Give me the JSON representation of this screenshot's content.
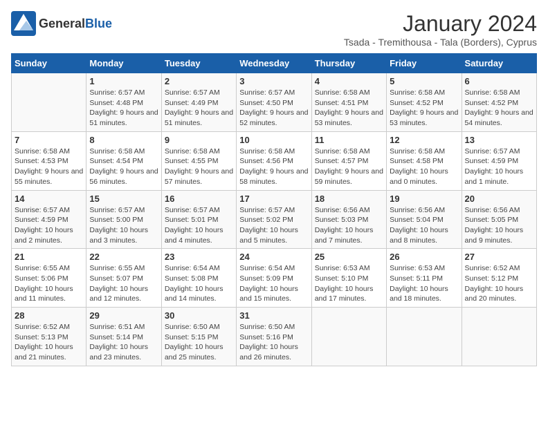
{
  "logo": {
    "general": "General",
    "blue": "Blue"
  },
  "title": "January 2024",
  "subtitle": "Tsada - Tremithousa - Tala (Borders), Cyprus",
  "days_of_week": [
    "Sunday",
    "Monday",
    "Tuesday",
    "Wednesday",
    "Thursday",
    "Friday",
    "Saturday"
  ],
  "weeks": [
    [
      {
        "day": "",
        "sunrise": "",
        "sunset": "",
        "daylight": ""
      },
      {
        "day": "1",
        "sunrise": "Sunrise: 6:57 AM",
        "sunset": "Sunset: 4:48 PM",
        "daylight": "Daylight: 9 hours and 51 minutes."
      },
      {
        "day": "2",
        "sunrise": "Sunrise: 6:57 AM",
        "sunset": "Sunset: 4:49 PM",
        "daylight": "Daylight: 9 hours and 51 minutes."
      },
      {
        "day": "3",
        "sunrise": "Sunrise: 6:57 AM",
        "sunset": "Sunset: 4:50 PM",
        "daylight": "Daylight: 9 hours and 52 minutes."
      },
      {
        "day": "4",
        "sunrise": "Sunrise: 6:58 AM",
        "sunset": "Sunset: 4:51 PM",
        "daylight": "Daylight: 9 hours and 53 minutes."
      },
      {
        "day": "5",
        "sunrise": "Sunrise: 6:58 AM",
        "sunset": "Sunset: 4:52 PM",
        "daylight": "Daylight: 9 hours and 53 minutes."
      },
      {
        "day": "6",
        "sunrise": "Sunrise: 6:58 AM",
        "sunset": "Sunset: 4:52 PM",
        "daylight": "Daylight: 9 hours and 54 minutes."
      }
    ],
    [
      {
        "day": "7",
        "sunrise": "Sunrise: 6:58 AM",
        "sunset": "Sunset: 4:53 PM",
        "daylight": "Daylight: 9 hours and 55 minutes."
      },
      {
        "day": "8",
        "sunrise": "Sunrise: 6:58 AM",
        "sunset": "Sunset: 4:54 PM",
        "daylight": "Daylight: 9 hours and 56 minutes."
      },
      {
        "day": "9",
        "sunrise": "Sunrise: 6:58 AM",
        "sunset": "Sunset: 4:55 PM",
        "daylight": "Daylight: 9 hours and 57 minutes."
      },
      {
        "day": "10",
        "sunrise": "Sunrise: 6:58 AM",
        "sunset": "Sunset: 4:56 PM",
        "daylight": "Daylight: 9 hours and 58 minutes."
      },
      {
        "day": "11",
        "sunrise": "Sunrise: 6:58 AM",
        "sunset": "Sunset: 4:57 PM",
        "daylight": "Daylight: 9 hours and 59 minutes."
      },
      {
        "day": "12",
        "sunrise": "Sunrise: 6:58 AM",
        "sunset": "Sunset: 4:58 PM",
        "daylight": "Daylight: 10 hours and 0 minutes."
      },
      {
        "day": "13",
        "sunrise": "Sunrise: 6:57 AM",
        "sunset": "Sunset: 4:59 PM",
        "daylight": "Daylight: 10 hours and 1 minute."
      }
    ],
    [
      {
        "day": "14",
        "sunrise": "Sunrise: 6:57 AM",
        "sunset": "Sunset: 4:59 PM",
        "daylight": "Daylight: 10 hours and 2 minutes."
      },
      {
        "day": "15",
        "sunrise": "Sunrise: 6:57 AM",
        "sunset": "Sunset: 5:00 PM",
        "daylight": "Daylight: 10 hours and 3 minutes."
      },
      {
        "day": "16",
        "sunrise": "Sunrise: 6:57 AM",
        "sunset": "Sunset: 5:01 PM",
        "daylight": "Daylight: 10 hours and 4 minutes."
      },
      {
        "day": "17",
        "sunrise": "Sunrise: 6:57 AM",
        "sunset": "Sunset: 5:02 PM",
        "daylight": "Daylight: 10 hours and 5 minutes."
      },
      {
        "day": "18",
        "sunrise": "Sunrise: 6:56 AM",
        "sunset": "Sunset: 5:03 PM",
        "daylight": "Daylight: 10 hours and 7 minutes."
      },
      {
        "day": "19",
        "sunrise": "Sunrise: 6:56 AM",
        "sunset": "Sunset: 5:04 PM",
        "daylight": "Daylight: 10 hours and 8 minutes."
      },
      {
        "day": "20",
        "sunrise": "Sunrise: 6:56 AM",
        "sunset": "Sunset: 5:05 PM",
        "daylight": "Daylight: 10 hours and 9 minutes."
      }
    ],
    [
      {
        "day": "21",
        "sunrise": "Sunrise: 6:55 AM",
        "sunset": "Sunset: 5:06 PM",
        "daylight": "Daylight: 10 hours and 11 minutes."
      },
      {
        "day": "22",
        "sunrise": "Sunrise: 6:55 AM",
        "sunset": "Sunset: 5:07 PM",
        "daylight": "Daylight: 10 hours and 12 minutes."
      },
      {
        "day": "23",
        "sunrise": "Sunrise: 6:54 AM",
        "sunset": "Sunset: 5:08 PM",
        "daylight": "Daylight: 10 hours and 14 minutes."
      },
      {
        "day": "24",
        "sunrise": "Sunrise: 6:54 AM",
        "sunset": "Sunset: 5:09 PM",
        "daylight": "Daylight: 10 hours and 15 minutes."
      },
      {
        "day": "25",
        "sunrise": "Sunrise: 6:53 AM",
        "sunset": "Sunset: 5:10 PM",
        "daylight": "Daylight: 10 hours and 17 minutes."
      },
      {
        "day": "26",
        "sunrise": "Sunrise: 6:53 AM",
        "sunset": "Sunset: 5:11 PM",
        "daylight": "Daylight: 10 hours and 18 minutes."
      },
      {
        "day": "27",
        "sunrise": "Sunrise: 6:52 AM",
        "sunset": "Sunset: 5:12 PM",
        "daylight": "Daylight: 10 hours and 20 minutes."
      }
    ],
    [
      {
        "day": "28",
        "sunrise": "Sunrise: 6:52 AM",
        "sunset": "Sunset: 5:13 PM",
        "daylight": "Daylight: 10 hours and 21 minutes."
      },
      {
        "day": "29",
        "sunrise": "Sunrise: 6:51 AM",
        "sunset": "Sunset: 5:14 PM",
        "daylight": "Daylight: 10 hours and 23 minutes."
      },
      {
        "day": "30",
        "sunrise": "Sunrise: 6:50 AM",
        "sunset": "Sunset: 5:15 PM",
        "daylight": "Daylight: 10 hours and 25 minutes."
      },
      {
        "day": "31",
        "sunrise": "Sunrise: 6:50 AM",
        "sunset": "Sunset: 5:16 PM",
        "daylight": "Daylight: 10 hours and 26 minutes."
      },
      {
        "day": "",
        "sunrise": "",
        "sunset": "",
        "daylight": ""
      },
      {
        "day": "",
        "sunrise": "",
        "sunset": "",
        "daylight": ""
      },
      {
        "day": "",
        "sunrise": "",
        "sunset": "",
        "daylight": ""
      }
    ]
  ]
}
